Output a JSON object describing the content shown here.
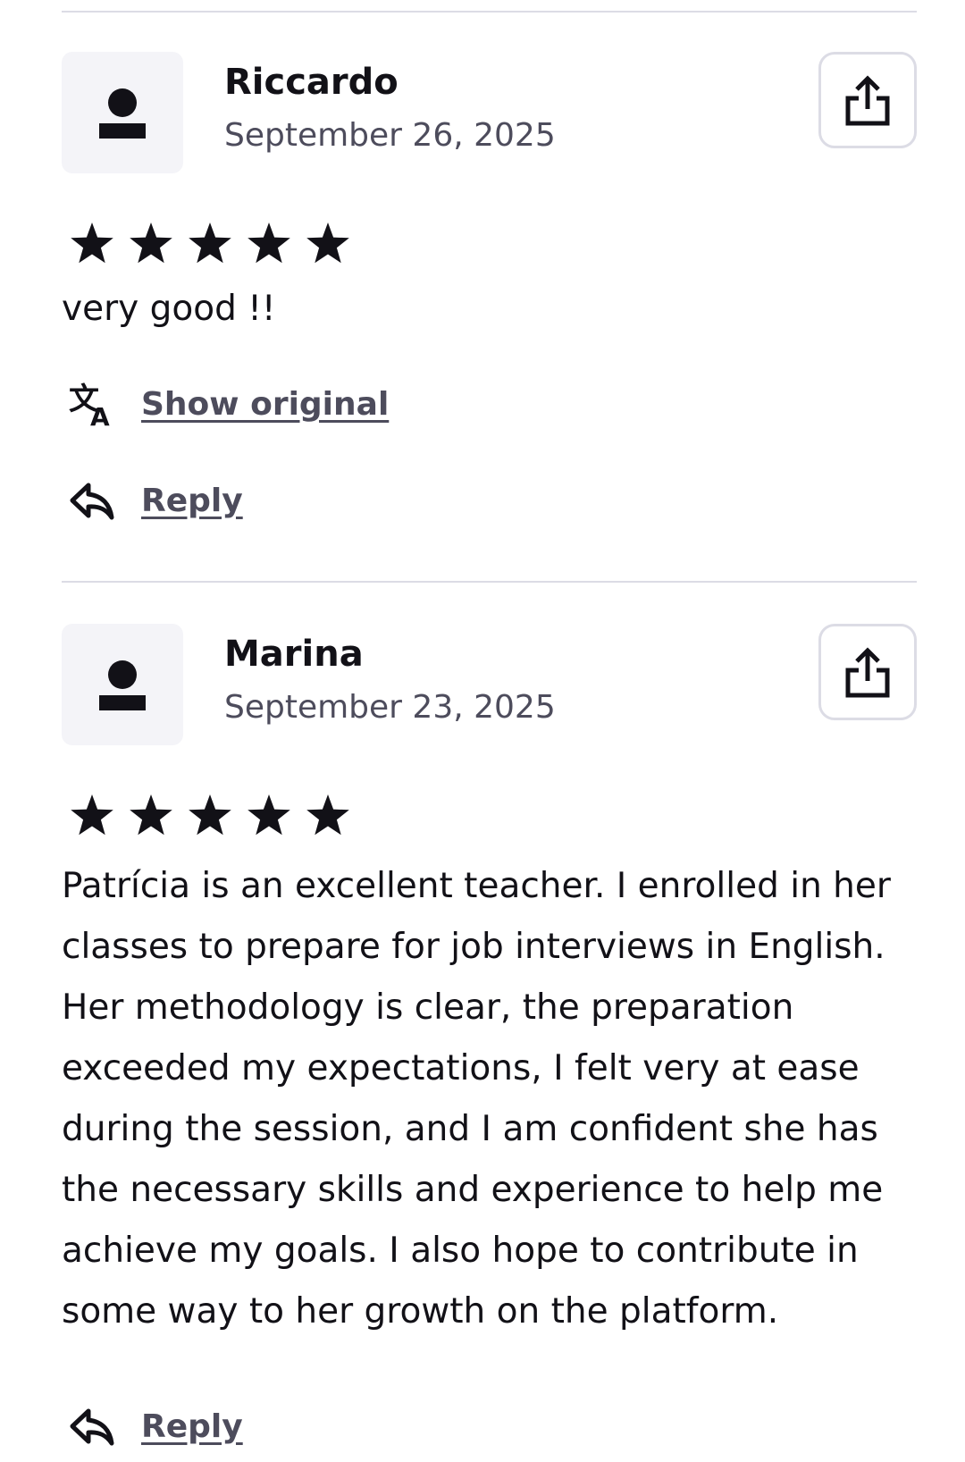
{
  "reviews": [
    {
      "author": "Riccardo",
      "date": "September 26, 2025",
      "rating": 5,
      "text": "very good !!",
      "translate_label": "Show original",
      "reply_label": "Reply"
    },
    {
      "author": "Marina",
      "date": "September 23, 2025",
      "rating": 5,
      "text": "Patrícia is an excellent teacher. I enrolled in her classes to prepare for job interviews in English. Her methodology is clear, the preparation exceeded my expectations, I felt very at ease during the session, and I am confident she has the necessary skills and experience to help me achieve my goals. I also hope to contribute in some way to her growth on the platform.",
      "reply_label": "Reply"
    }
  ],
  "icons": {
    "avatar": "user-icon",
    "share": "share-icon",
    "star": "star-icon",
    "translate": "translate-icon",
    "reply": "reply-arrow-icon"
  },
  "colors": {
    "text": "#121117",
    "secondary_text": "#4d4c5c",
    "divider": "#dcdce5",
    "avatar_bg": "#f4f4f8"
  }
}
